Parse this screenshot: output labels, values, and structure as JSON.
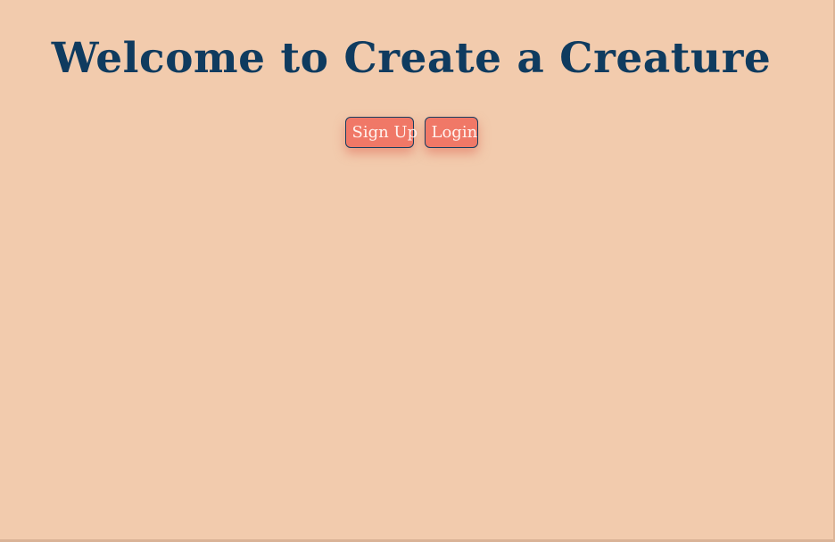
{
  "header": {
    "title": "Welcome to Create a Creature"
  },
  "auth": {
    "signup_label": "Sign Up",
    "login_label": "Login"
  },
  "colors": {
    "background": "#f2cbad",
    "title": "#0f3b5f",
    "button_fill": "#f07867",
    "button_border": "#163e60",
    "button_text": "#fff3ef"
  }
}
